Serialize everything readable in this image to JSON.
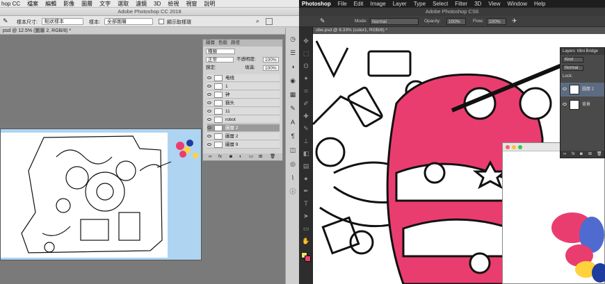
{
  "left_app": {
    "menubar": [
      "hop CC",
      "檔案",
      "編輯",
      "影像",
      "圖層",
      "文字",
      "選取",
      "濾鏡",
      "3D",
      "檢視",
      "視窗",
      "說明"
    ],
    "window_title": "Adobe Photoshop CC 2018",
    "options": {
      "sample_select": "點狀樣本",
      "layers_select": "全部圖層",
      "show_ring": "顯示取樣環"
    },
    "document_tab": "psd @ 12.5% (圖層 2, RGB/8) *",
    "layers_panel": {
      "tabs": [
        "圖層",
        "色版",
        "路徑"
      ],
      "kind": "種類",
      "blend_mode": "正常",
      "opacity_label": "不透明度:",
      "opacity_value": "100%",
      "lock_label": "鎖定:",
      "fill_label": "填滿:",
      "fill_value": "100%",
      "layers": [
        {
          "name": "电线",
          "selected": false
        },
        {
          "name": "1",
          "selected": false
        },
        {
          "name": "钟",
          "selected": false
        },
        {
          "name": "猫头",
          "selected": false
        },
        {
          "name": "11",
          "selected": false
        },
        {
          "name": "robot",
          "selected": false
        },
        {
          "name": "圖層 2",
          "selected": true
        },
        {
          "name": "圖層 2",
          "selected": false
        },
        {
          "name": "圖層 9",
          "selected": false
        }
      ]
    }
  },
  "right_app": {
    "menubar": [
      "Photoshop",
      "File",
      "Edit",
      "Image",
      "Layer",
      "Type",
      "Select",
      "Filter",
      "3D",
      "View",
      "Window",
      "Help"
    ],
    "window_title": "Adobe Photoshop CS6",
    "options": {
      "mode_label": "Mode:",
      "mode_value": "Normal",
      "opacity_label": "Opacity:",
      "opacity_value": "100%",
      "flow_label": "Flow:",
      "flow_value": "100%"
    },
    "document_tab": "obe.psd @ 8.33% (color1, RGB/8) *",
    "layers_panel": {
      "tabs": [
        "Layers",
        "Mini Bridge"
      ],
      "kind": "Kind",
      "blend_mode": "Normal",
      "lock_label": "Lock:",
      "layers": [
        {
          "name": "圖層 2",
          "selected": true
        },
        {
          "name": "背景",
          "selected": false
        }
      ]
    }
  },
  "colors": {
    "pink": "#ea3d6f",
    "sky": "#aed4f2",
    "cs6_dark": "#3a3a3a"
  }
}
